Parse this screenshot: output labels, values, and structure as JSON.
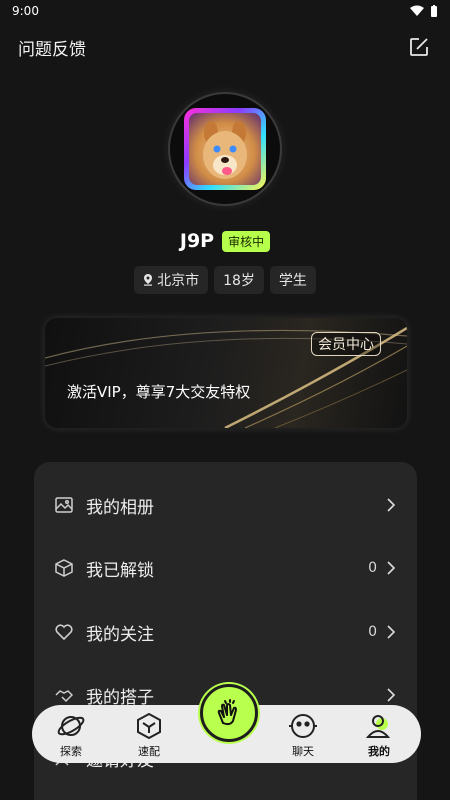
{
  "status_bar": {
    "time": "9:00"
  },
  "header": {
    "title": "问题反馈"
  },
  "profile": {
    "name": "J9P",
    "status": "审核中",
    "tags": {
      "city": "北京市",
      "age": "18岁",
      "occupation": "学生"
    }
  },
  "vip": {
    "badge": "会员中心",
    "text": "激活VIP，尊享7大交友特权"
  },
  "menu": {
    "album": {
      "label": "我的相册"
    },
    "unlocked": {
      "label": "我已解锁",
      "count": "0"
    },
    "following": {
      "label": "我的关注",
      "count": "0"
    },
    "partners": {
      "label": "我的搭子"
    },
    "invite": {
      "label": "邀请好友"
    }
  },
  "tabs": {
    "explore": "探索",
    "match": "速配",
    "chat": "聊天",
    "mine": "我的"
  },
  "colors": {
    "accent": "#b9ff4e",
    "background": "#151515",
    "panel": "#262626"
  }
}
